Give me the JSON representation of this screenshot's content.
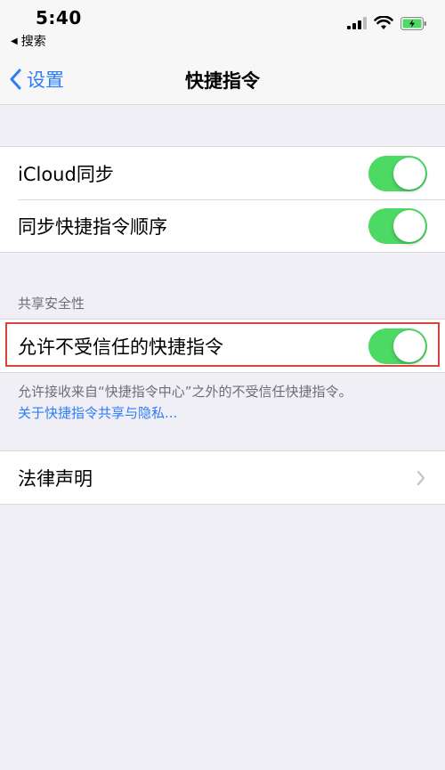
{
  "status_bar": {
    "time": "5:40",
    "back_app": "搜索"
  },
  "nav": {
    "back_label": "设置",
    "title": "快捷指令"
  },
  "group1": {
    "items": [
      {
        "label": "iCloud同步",
        "on": true
      },
      {
        "label": "同步快捷指令顺序",
        "on": true
      }
    ]
  },
  "section_security": {
    "header": "共享安全性",
    "item": {
      "label": "允许不受信任的快捷指令",
      "on": true
    },
    "footer": "允许接收来自“快捷指令中心”之外的不受信任快捷指令。",
    "footer_link": "关于快捷指令共享与隐私..."
  },
  "group3": {
    "legal_label": "法律声明"
  },
  "colors": {
    "toggle_on": "#4cd964",
    "accent": "#2e7cf6",
    "highlight": "#d9433b"
  }
}
